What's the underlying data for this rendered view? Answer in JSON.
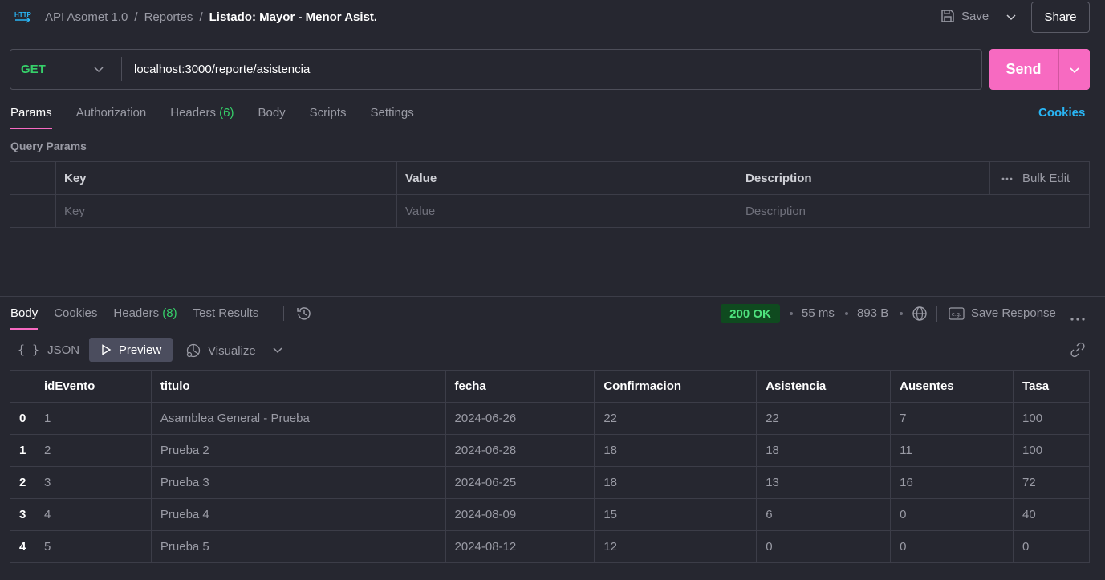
{
  "header": {
    "breadcrumb": [
      "API Asomet 1.0",
      "Reportes"
    ],
    "current": "Listado: Mayor - Menor Asist.",
    "save_label": "Save",
    "share_label": "Share"
  },
  "request": {
    "method": "GET",
    "url": "localhost:3000/reporte/asistencia",
    "send_label": "Send"
  },
  "req_tabs": {
    "params": "Params",
    "authorization": "Authorization",
    "headers": "Headers",
    "headers_count": "(6)",
    "body": "Body",
    "scripts": "Scripts",
    "settings": "Settings",
    "cookies": "Cookies"
  },
  "query_params": {
    "title": "Query Params",
    "col_key": "Key",
    "col_value": "Value",
    "col_description": "Description",
    "bulk_edit": "Bulk Edit",
    "ph_key": "Key",
    "ph_value": "Value",
    "ph_description": "Description"
  },
  "response": {
    "tabs": {
      "body": "Body",
      "cookies": "Cookies",
      "headers": "Headers",
      "headers_count": "(8)",
      "tests": "Test Results"
    },
    "status": "200 OK",
    "time": "55 ms",
    "size": "893 B",
    "save_response": "Save Response",
    "formats": {
      "json": "JSON",
      "preview": "Preview",
      "visualize": "Visualize"
    },
    "columns": [
      "idEvento",
      "titulo",
      "fecha",
      "Confirmacion",
      "Asistencia",
      "Ausentes",
      "Tasa"
    ],
    "rows": [
      [
        "0",
        "1",
        "Asamblea General - Prueba",
        "2024-06-26",
        "22",
        "22",
        "7",
        "100"
      ],
      [
        "1",
        "2",
        "Prueba 2",
        "2024-06-28",
        "18",
        "18",
        "11",
        "100"
      ],
      [
        "2",
        "3",
        "Prueba 3",
        "2024-06-25",
        "18",
        "13",
        "16",
        "72"
      ],
      [
        "3",
        "4",
        "Prueba 4",
        "2024-08-09",
        "15",
        "6",
        "0",
        "40"
      ],
      [
        "4",
        "5",
        "Prueba 5",
        "2024-08-12",
        "12",
        "0",
        "0",
        "0"
      ]
    ]
  },
  "colors": {
    "accent": "#f76ac1",
    "ok": "#4ee37e",
    "link": "#29b6f6",
    "method": "#36d06a"
  }
}
